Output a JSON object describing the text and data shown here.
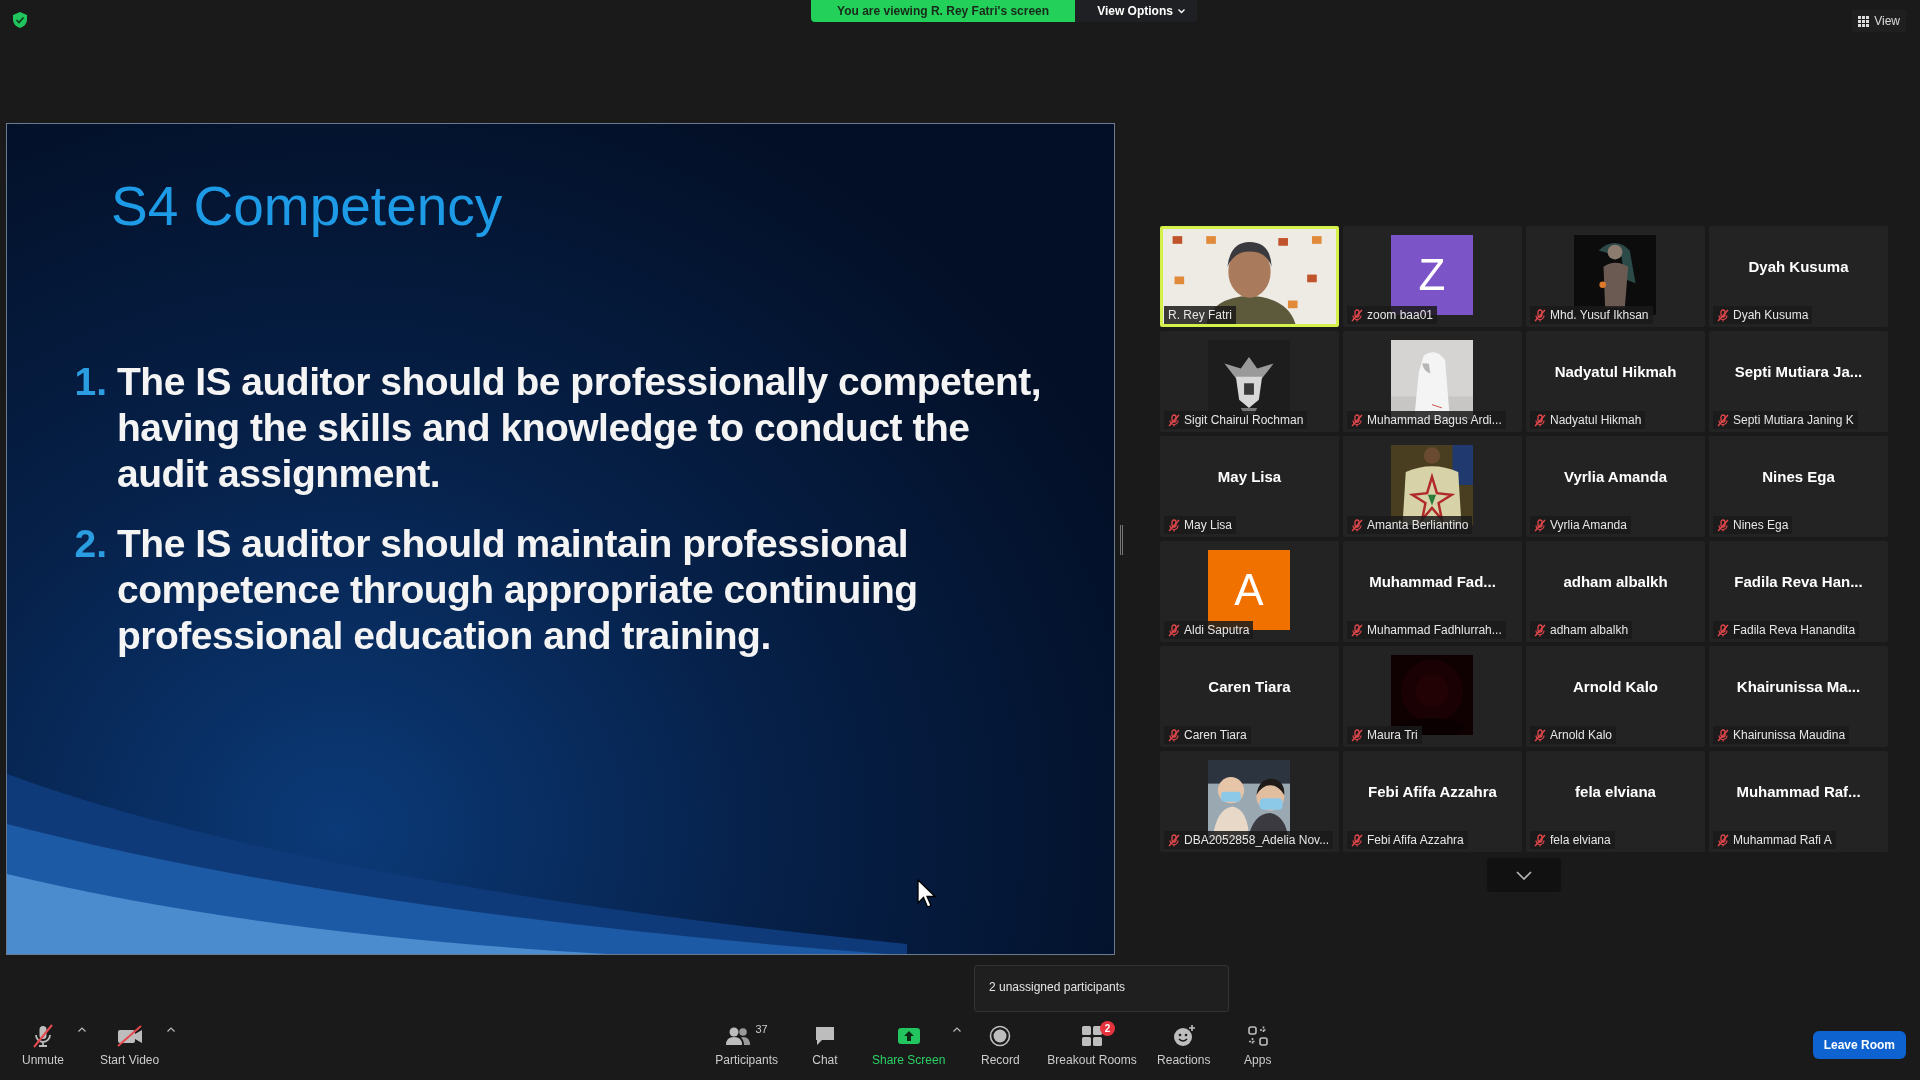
{
  "top_bar": {
    "banner": "You are viewing R. Rey Fatri's screen",
    "view_options": "View Options",
    "view": "View"
  },
  "slide": {
    "title": "S4 Competency",
    "points": [
      {
        "number": "1.",
        "text": "The IS auditor should be professionally competent, having the skills and knowledge to conduct the audit assignment."
      },
      {
        "number": "2.",
        "text": "The IS auditor should maintain professional competence through appropriate continuing professional education and training."
      }
    ]
  },
  "participants": [
    {
      "kind": "video",
      "label": "R. Rey Fatri",
      "muted": false,
      "speaking": true
    },
    {
      "kind": "letter",
      "letter": "Z",
      "color": "#7b55c7",
      "label": "zoom baa01",
      "muted": true,
      "speaking": false
    },
    {
      "kind": "video",
      "label": "Mhd. Yusuf Ikhsan",
      "muted": true,
      "speaking": false
    },
    {
      "kind": "name",
      "display_name": "Dyah Kusuma",
      "label": "Dyah Kusuma",
      "muted": true,
      "speaking": false
    },
    {
      "kind": "video",
      "label": "Sigit Chairul Rochman",
      "muted": true,
      "speaking": false
    },
    {
      "kind": "video",
      "label": "Muhammad Bagus Ardi...",
      "muted": true,
      "speaking": false
    },
    {
      "kind": "name",
      "display_name": "Nadyatul Hikmah",
      "label": "Nadyatul Hikmah",
      "muted": true,
      "speaking": false
    },
    {
      "kind": "name",
      "display_name": "Septi Mutiara Ja...",
      "label": "Septi Mutiara Janing K",
      "muted": true,
      "speaking": false
    },
    {
      "kind": "name",
      "display_name": "May Lisa",
      "label": "May Lisa",
      "muted": true,
      "speaking": false
    },
    {
      "kind": "video",
      "label": "Amanta Berliantino",
      "muted": true,
      "speaking": false
    },
    {
      "kind": "name",
      "display_name": "Vyrlia Amanda",
      "label": "Vyrlia Amanda",
      "muted": true,
      "speaking": false
    },
    {
      "kind": "name",
      "display_name": "Nines Ega",
      "label": "Nines Ega",
      "muted": true,
      "speaking": false
    },
    {
      "kind": "letter",
      "letter": "A",
      "color": "#f07000",
      "label": "Aldi Saputra",
      "muted": true,
      "speaking": false
    },
    {
      "kind": "name",
      "display_name": "Muhammad Fad...",
      "label": "Muhammad Fadhlurrah...",
      "muted": true,
      "speaking": false
    },
    {
      "kind": "name",
      "display_name": "adham albalkh",
      "label": "adham albalkh",
      "muted": true,
      "speaking": false
    },
    {
      "kind": "name",
      "display_name": "Fadila Reva Han...",
      "label": "Fadila Reva Hanandita",
      "muted": true,
      "speaking": false
    },
    {
      "kind": "name",
      "display_name": "Caren Tiara",
      "label": "Caren Tiara",
      "muted": true,
      "speaking": false
    },
    {
      "kind": "video",
      "label": "Maura Tri",
      "muted": true,
      "speaking": false
    },
    {
      "kind": "name",
      "display_name": "Arnold Kalo",
      "label": "Arnold Kalo",
      "muted": true,
      "speaking": false
    },
    {
      "kind": "name",
      "display_name": "Khairunissa Ma...",
      "label": "Khairunissa Maudina",
      "muted": true,
      "speaking": false
    },
    {
      "kind": "video",
      "label": "DBA2052858_Adelia Nov...",
      "muted": true,
      "speaking": false
    },
    {
      "kind": "name",
      "display_name": "Febi Afifa Azzahra",
      "label": "Febi Afifa Azzahra",
      "muted": true,
      "speaking": false
    },
    {
      "kind": "name",
      "display_name": "fela elviana",
      "label": "fela elviana",
      "muted": true,
      "speaking": false
    },
    {
      "kind": "name",
      "display_name": "Muhammad Raf...",
      "label": "Muhammad Rafi A",
      "muted": true,
      "speaking": false
    }
  ],
  "tooltip": "2 unassigned participants",
  "audio_video": [
    {
      "kind": "mic",
      "label": "Unmute",
      "off": true,
      "has_menu": true
    },
    {
      "kind": "camera",
      "label": "Start Video",
      "off": true,
      "has_menu": true
    }
  ],
  "controls": [
    {
      "kind": "participants",
      "label": "Participants",
      "count": "37",
      "has_menu": false
    },
    {
      "kind": "chat",
      "label": "Chat",
      "has_menu": false
    },
    {
      "kind": "share",
      "label": "Share Screen",
      "has_menu": true
    },
    {
      "kind": "record",
      "label": "Record",
      "has_menu": false
    },
    {
      "kind": "breakout",
      "label": "Breakout Rooms",
      "badge": "2",
      "has_menu": false
    },
    {
      "kind": "reactions",
      "label": "Reactions",
      "has_menu": false
    },
    {
      "kind": "apps",
      "label": "Apps",
      "has_menu": false
    }
  ],
  "leave_button": "Leave Room"
}
